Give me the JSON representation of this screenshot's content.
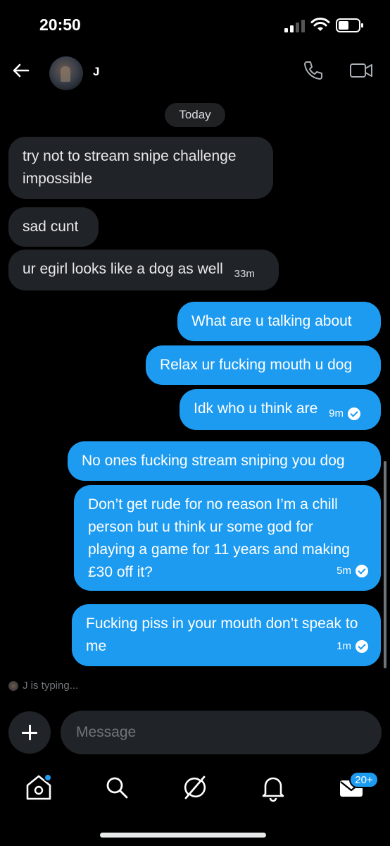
{
  "status_bar": {
    "time": "20:50"
  },
  "header": {
    "contact_name": "J"
  },
  "date_divider": "Today",
  "messages": [
    {
      "direction": "in",
      "text": "try not to stream snipe challenge impossible"
    },
    {
      "direction": "in",
      "text": "sad cunt"
    },
    {
      "direction": "in",
      "text": "ur egirl looks like a dog as well",
      "time": "33m"
    },
    {
      "direction": "out",
      "text": "What are u talking about"
    },
    {
      "direction": "out",
      "text": "Relax ur fucking mouth u dog"
    },
    {
      "direction": "out",
      "text": "Idk who u think are",
      "time": "9m",
      "read": true
    },
    {
      "direction": "out",
      "text": "No ones fucking stream sniping you dog"
    },
    {
      "direction": "out",
      "text": "Don’t get rude for no reason I’m a chill person but u think ur some god for playing a game for 11 years and making £30 off it?",
      "time": "5m",
      "read": true
    },
    {
      "direction": "out",
      "text": "Fucking piss in your mouth don’t speak to me",
      "time": "1m",
      "read": true
    }
  ],
  "typing_indicator": "J is typing...",
  "composer": {
    "placeholder": "Message"
  },
  "tab_bar": {
    "messages_badge": "20+"
  },
  "colors": {
    "accent": "#1d9bf0",
    "incoming_bubble": "#202327",
    "background": "#000000"
  }
}
